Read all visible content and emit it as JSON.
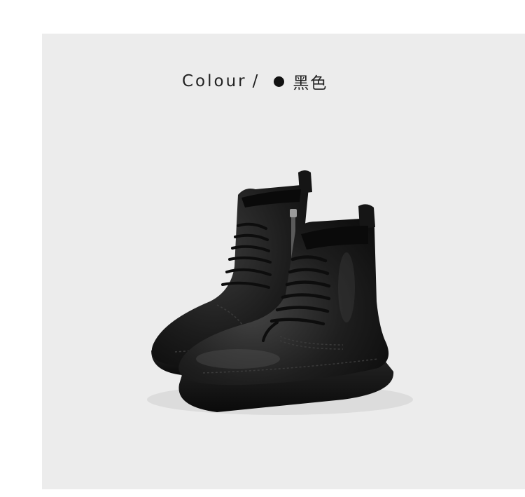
{
  "header": {
    "label": "Colour",
    "separator": "/",
    "swatch_color": "#111111",
    "color_name": "黑色"
  },
  "image": {
    "subject": "black-leather-lace-up-boots",
    "background_color": "#ececec"
  }
}
